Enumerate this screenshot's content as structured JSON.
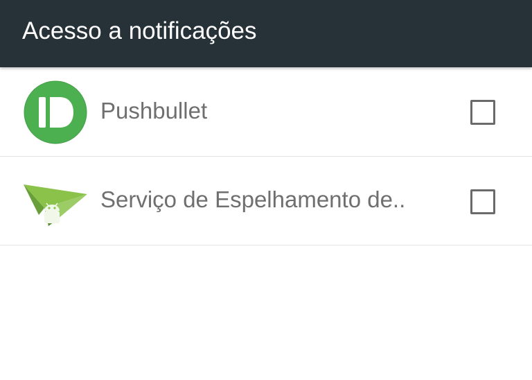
{
  "app_bar": {
    "title": "Acesso a notificações",
    "background": "#263238"
  },
  "items": [
    {
      "icon": "pushbullet-icon",
      "label": "Pushbullet",
      "checked": false
    },
    {
      "icon": "airdroid-paper-plane-icon",
      "label": "Serviço de Espelhamento de..",
      "checked": false
    }
  ],
  "colors": {
    "accent_green": "#4caf50",
    "label_gray": "#6f6f6f",
    "divider": "#e3e3e3"
  }
}
